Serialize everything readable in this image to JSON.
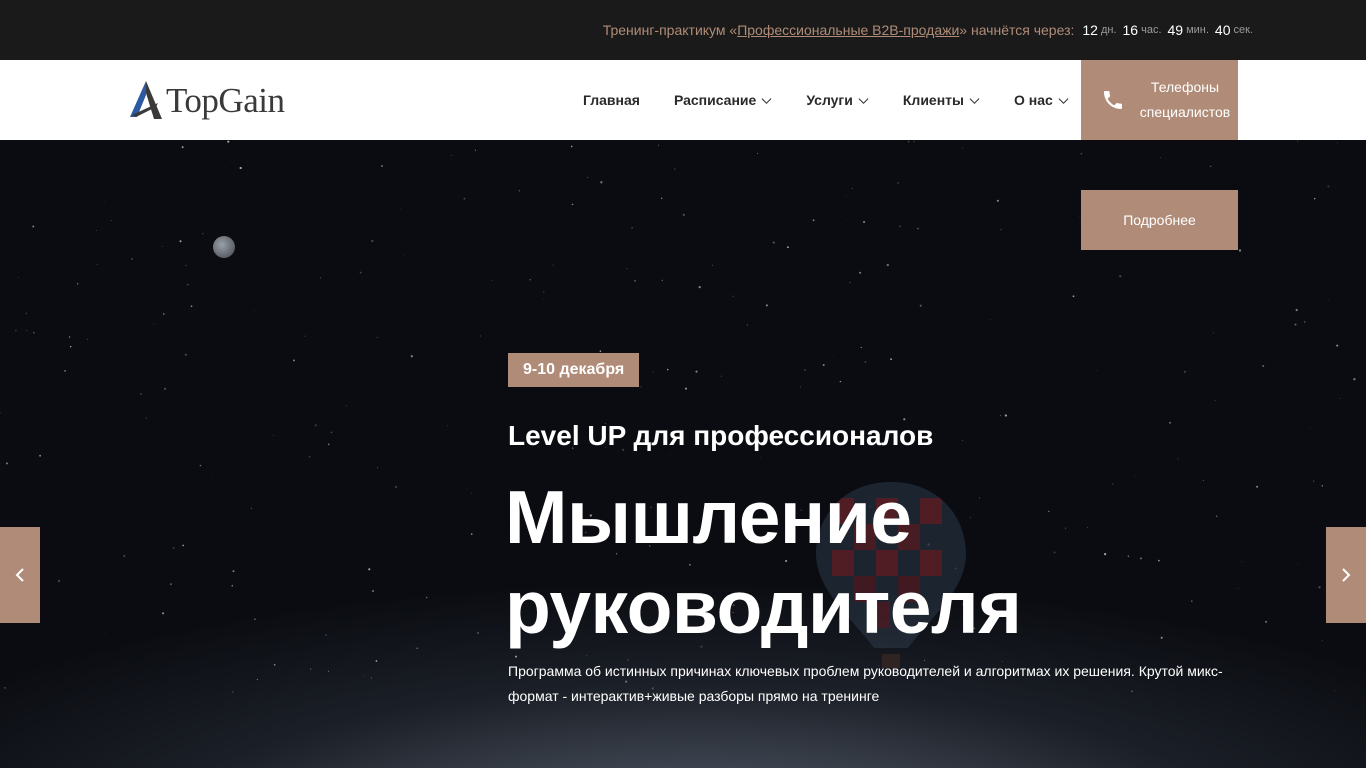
{
  "topbar": {
    "prefix": "Тренинг-практикум «",
    "link": "Профессиональные В2В-продажи",
    "suffix": "» начнётся через:",
    "countdown": [
      {
        "value": "12",
        "unit": "дн."
      },
      {
        "value": "16",
        "unit": "час."
      },
      {
        "value": "49",
        "unit": "мин."
      },
      {
        "value": "40",
        "unit": "сек."
      }
    ]
  },
  "header": {
    "logo_text": "TopGain",
    "nav": [
      {
        "label": "Главная",
        "has_dropdown": false
      },
      {
        "label": "Расписание",
        "has_dropdown": true
      },
      {
        "label": "Услуги",
        "has_dropdown": true
      },
      {
        "label": "Клиенты",
        "has_dropdown": true
      },
      {
        "label": "О нас",
        "has_dropdown": true
      }
    ],
    "phone_button": {
      "line1": "Телефоны",
      "line2": "специалистов",
      "icon": "phone-icon"
    }
  },
  "hero": {
    "more_button": "Подробнее",
    "date": "9-10 декабря",
    "subtitle": "Level UP для профессионалов",
    "title_line1": "Мышление",
    "title_line2": "руководителя",
    "description": "Программа об истинных причинах ключевых проблем руководителей и алгоритмах их решения. Крутой микс-формат - интерактив+живые разборы прямо на тренинге",
    "prev_icon": "chevron-left-icon",
    "next_icon": "chevron-right-icon"
  },
  "colors": {
    "accent": "#b08c78",
    "topbar_bg": "#1a1a1a",
    "header_bg": "#ffffff",
    "nav_text": "#2a2a2a"
  }
}
